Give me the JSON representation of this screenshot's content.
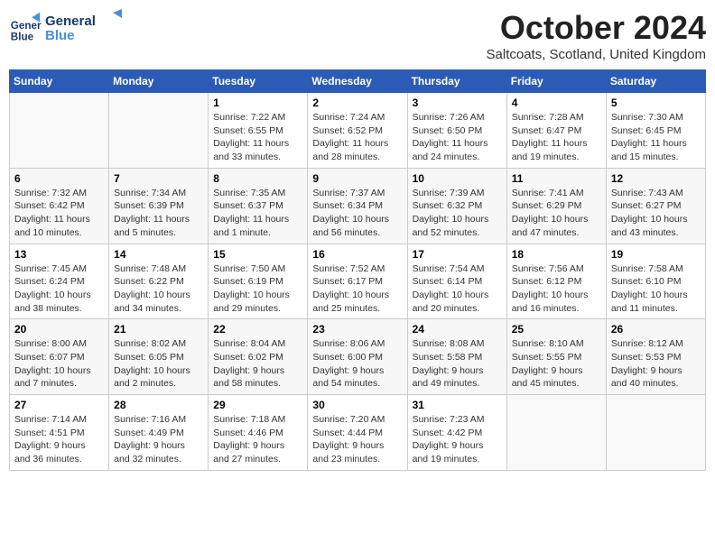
{
  "header": {
    "logo_line1": "General",
    "logo_line2": "Blue",
    "month": "October 2024",
    "location": "Saltcoats, Scotland, United Kingdom"
  },
  "days_of_week": [
    "Sunday",
    "Monday",
    "Tuesday",
    "Wednesday",
    "Thursday",
    "Friday",
    "Saturday"
  ],
  "weeks": [
    [
      {
        "day": "",
        "info": ""
      },
      {
        "day": "",
        "info": ""
      },
      {
        "day": "1",
        "info": "Sunrise: 7:22 AM\nSunset: 6:55 PM\nDaylight: 11 hours\nand 33 minutes."
      },
      {
        "day": "2",
        "info": "Sunrise: 7:24 AM\nSunset: 6:52 PM\nDaylight: 11 hours\nand 28 minutes."
      },
      {
        "day": "3",
        "info": "Sunrise: 7:26 AM\nSunset: 6:50 PM\nDaylight: 11 hours\nand 24 minutes."
      },
      {
        "day": "4",
        "info": "Sunrise: 7:28 AM\nSunset: 6:47 PM\nDaylight: 11 hours\nand 19 minutes."
      },
      {
        "day": "5",
        "info": "Sunrise: 7:30 AM\nSunset: 6:45 PM\nDaylight: 11 hours\nand 15 minutes."
      }
    ],
    [
      {
        "day": "6",
        "info": "Sunrise: 7:32 AM\nSunset: 6:42 PM\nDaylight: 11 hours\nand 10 minutes."
      },
      {
        "day": "7",
        "info": "Sunrise: 7:34 AM\nSunset: 6:39 PM\nDaylight: 11 hours\nand 5 minutes."
      },
      {
        "day": "8",
        "info": "Sunrise: 7:35 AM\nSunset: 6:37 PM\nDaylight: 11 hours\nand 1 minute."
      },
      {
        "day": "9",
        "info": "Sunrise: 7:37 AM\nSunset: 6:34 PM\nDaylight: 10 hours\nand 56 minutes."
      },
      {
        "day": "10",
        "info": "Sunrise: 7:39 AM\nSunset: 6:32 PM\nDaylight: 10 hours\nand 52 minutes."
      },
      {
        "day": "11",
        "info": "Sunrise: 7:41 AM\nSunset: 6:29 PM\nDaylight: 10 hours\nand 47 minutes."
      },
      {
        "day": "12",
        "info": "Sunrise: 7:43 AM\nSunset: 6:27 PM\nDaylight: 10 hours\nand 43 minutes."
      }
    ],
    [
      {
        "day": "13",
        "info": "Sunrise: 7:45 AM\nSunset: 6:24 PM\nDaylight: 10 hours\nand 38 minutes."
      },
      {
        "day": "14",
        "info": "Sunrise: 7:48 AM\nSunset: 6:22 PM\nDaylight: 10 hours\nand 34 minutes."
      },
      {
        "day": "15",
        "info": "Sunrise: 7:50 AM\nSunset: 6:19 PM\nDaylight: 10 hours\nand 29 minutes."
      },
      {
        "day": "16",
        "info": "Sunrise: 7:52 AM\nSunset: 6:17 PM\nDaylight: 10 hours\nand 25 minutes."
      },
      {
        "day": "17",
        "info": "Sunrise: 7:54 AM\nSunset: 6:14 PM\nDaylight: 10 hours\nand 20 minutes."
      },
      {
        "day": "18",
        "info": "Sunrise: 7:56 AM\nSunset: 6:12 PM\nDaylight: 10 hours\nand 16 minutes."
      },
      {
        "day": "19",
        "info": "Sunrise: 7:58 AM\nSunset: 6:10 PM\nDaylight: 10 hours\nand 11 minutes."
      }
    ],
    [
      {
        "day": "20",
        "info": "Sunrise: 8:00 AM\nSunset: 6:07 PM\nDaylight: 10 hours\nand 7 minutes."
      },
      {
        "day": "21",
        "info": "Sunrise: 8:02 AM\nSunset: 6:05 PM\nDaylight: 10 hours\nand 2 minutes."
      },
      {
        "day": "22",
        "info": "Sunrise: 8:04 AM\nSunset: 6:02 PM\nDaylight: 9 hours\nand 58 minutes."
      },
      {
        "day": "23",
        "info": "Sunrise: 8:06 AM\nSunset: 6:00 PM\nDaylight: 9 hours\nand 54 minutes."
      },
      {
        "day": "24",
        "info": "Sunrise: 8:08 AM\nSunset: 5:58 PM\nDaylight: 9 hours\nand 49 minutes."
      },
      {
        "day": "25",
        "info": "Sunrise: 8:10 AM\nSunset: 5:55 PM\nDaylight: 9 hours\nand 45 minutes."
      },
      {
        "day": "26",
        "info": "Sunrise: 8:12 AM\nSunset: 5:53 PM\nDaylight: 9 hours\nand 40 minutes."
      }
    ],
    [
      {
        "day": "27",
        "info": "Sunrise: 7:14 AM\nSunset: 4:51 PM\nDaylight: 9 hours\nand 36 minutes."
      },
      {
        "day": "28",
        "info": "Sunrise: 7:16 AM\nSunset: 4:49 PM\nDaylight: 9 hours\nand 32 minutes."
      },
      {
        "day": "29",
        "info": "Sunrise: 7:18 AM\nSunset: 4:46 PM\nDaylight: 9 hours\nand 27 minutes."
      },
      {
        "day": "30",
        "info": "Sunrise: 7:20 AM\nSunset: 4:44 PM\nDaylight: 9 hours\nand 23 minutes."
      },
      {
        "day": "31",
        "info": "Sunrise: 7:23 AM\nSunset: 4:42 PM\nDaylight: 9 hours\nand 19 minutes."
      },
      {
        "day": "",
        "info": ""
      },
      {
        "day": "",
        "info": ""
      }
    ]
  ]
}
